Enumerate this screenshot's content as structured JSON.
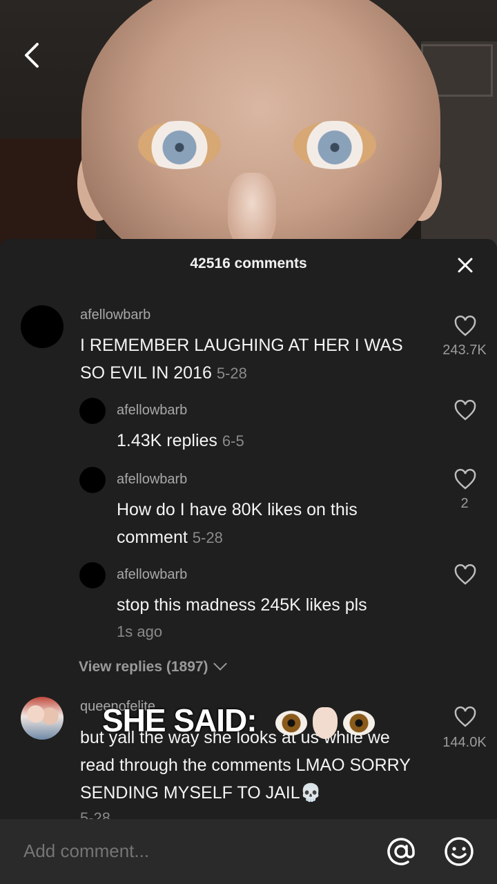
{
  "header": {
    "comment_count": "42516 comments"
  },
  "comments": [
    {
      "username": "afellowbarb",
      "text": "I REMEMBER LAUGHING AT HER I WAS SO EVIL IN 2016",
      "date": "5-28",
      "likes": "243.7K"
    },
    {
      "username": "afellowbarb",
      "text": "1.43K replies",
      "date": "6-5",
      "likes": ""
    },
    {
      "username": "afellowbarb",
      "text": "How do I have 80K likes on this comment",
      "date": "5-28",
      "likes": "2"
    },
    {
      "username": "afellowbarb",
      "text": "stop this madness 245K likes pls",
      "date": "1s ago",
      "likes": ""
    }
  ],
  "view_replies": "View replies (1897)",
  "second_comment": {
    "username": "queenofelite",
    "text": "but yall the way she looks at us while we read through the comments LMAO SORRY SENDING MYSELF TO JAIL",
    "date": "5-28",
    "likes": "144.0K"
  },
  "overlay_caption": "SHE SAID:",
  "input": {
    "placeholder": "Add comment..."
  },
  "icons": {
    "back": "chevron-left-icon",
    "close": "close-icon",
    "like": "heart-outline-icon",
    "mention": "at-icon",
    "emoji": "smile-icon",
    "skull": "skull-emoji"
  }
}
